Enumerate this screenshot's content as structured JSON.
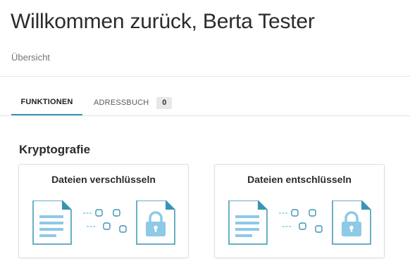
{
  "header": {
    "title": "Willkommen zurück, Berta Tester",
    "breadcrumb": "Übersicht"
  },
  "tabs": [
    {
      "label": "FUNKTIONEN",
      "active": true
    },
    {
      "label": "ADRESSBUCH",
      "count": "0",
      "active": false
    }
  ],
  "section": {
    "title": "Kryptografie",
    "cards": [
      {
        "title": "Dateien verschlüsseln",
        "icon": "document-to-locked-file-icon"
      },
      {
        "title": "Dateien entschlüsseln",
        "icon": "document-to-locked-file-icon"
      }
    ]
  },
  "colors": {
    "accent": "#3a93b4",
    "icon_fill": "#8ec9e6",
    "icon_stroke": "#3a93b4"
  }
}
